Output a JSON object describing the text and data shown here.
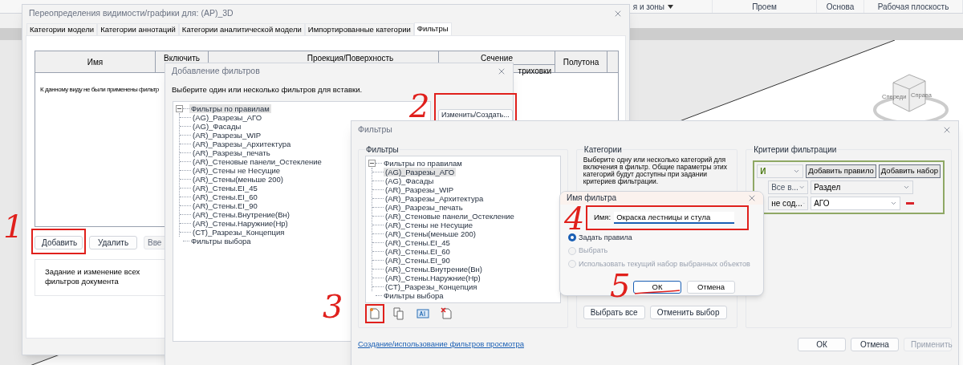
{
  "ribbon": {
    "items": [
      {
        "label": "я и зоны",
        "dropdown": true
      },
      {
        "label": "Проем",
        "dropdown": false
      },
      {
        "label": "Основа",
        "dropdown": false
      },
      {
        "label": "Рабочая плоскость",
        "dropdown": false
      }
    ]
  },
  "view_cube": {
    "faces": [
      "Спереди",
      "Справа"
    ]
  },
  "visibility_dialog": {
    "title": "Переопределения видимости/графики для: (АР)_3D",
    "tabs": [
      {
        "label": "Категории модели",
        "selected": false
      },
      {
        "label": "Категории аннотаций",
        "selected": false
      },
      {
        "label": "Категории аналитической модели",
        "selected": false
      },
      {
        "label": "Импортированные категории",
        "selected": false
      },
      {
        "label": "Фильтры",
        "selected": true
      }
    ],
    "columns": [
      {
        "label": "Имя"
      },
      {
        "label": "Включить"
      },
      {
        "label": "Проекция/Поверхность"
      },
      {
        "label": "Сечение",
        "sublabel": "триховки"
      },
      {
        "label": "Полутона"
      }
    ],
    "note": "К данному виду не были применены фильтр",
    "buttons": [
      {
        "label": "Добавить",
        "highlighted": true,
        "disabled": false
      },
      {
        "label": "Удалить",
        "highlighted": false,
        "disabled": false
      },
      {
        "label": "Вве",
        "highlighted": false,
        "disabled": true
      }
    ],
    "group_text": "Задание и изменение всех фильтров документа"
  },
  "add_filters_dialog": {
    "title": "Добавление фильтров",
    "prompt": "Выберите один или несколько фильтров для вставки.",
    "tree": [
      {
        "label": "Фильтры по правилам",
        "selected": true,
        "expanded": true,
        "children": [
          {
            "label": "(AG)_Разрезы_АГО",
            "selected": false
          },
          {
            "label": "(AG)_Фасады",
            "selected": false
          },
          {
            "label": "(AR)_Разрезы_WIP",
            "selected": false
          },
          {
            "label": "(AR)_Разрезы_Архитектура",
            "selected": false
          },
          {
            "label": "(AR)_Разрезы_печать",
            "selected": false
          },
          {
            "label": "(AR)_Стеновые панели_Остекление",
            "selected": false
          },
          {
            "label": "(AR)_Стены не Несущие",
            "selected": false
          },
          {
            "label": "(AR)_Стены(меньше 200)",
            "selected": false
          },
          {
            "label": "(AR)_Стены.EI_45",
            "selected": false
          },
          {
            "label": "(AR)_Стены.EI_60",
            "selected": false
          },
          {
            "label": "(AR)_Стены.EI_90",
            "selected": false
          },
          {
            "label": "(AR)_Стены.Внутрение(Вн)",
            "selected": false
          },
          {
            "label": "(AR)_Стены.Наружние(Нр)",
            "selected": false
          },
          {
            "label": "(CT)_Разрезы_Концепция",
            "selected": false
          }
        ]
      },
      {
        "label": "Фильтры выбора",
        "selected": false
      }
    ],
    "button": {
      "label": "Изменить/Создать...",
      "highlighted": true
    }
  },
  "filters_dialog": {
    "title": "Фильтры",
    "filters_group": {
      "title": "Фильтры",
      "tree": [
        {
          "label": "Фильтры по правилам",
          "selected": false,
          "expanded": true,
          "children": [
            {
              "label": "(AG)_Разрезы_АГО",
              "selected": true
            },
            {
              "label": "(AG)_Фасады",
              "selected": false
            },
            {
              "label": "(AR)_Разрезы_WIP",
              "selected": false
            },
            {
              "label": "(AR)_Разрезы_Архитектура",
              "selected": false
            },
            {
              "label": "(AR)_Разрезы_печать",
              "selected": false
            },
            {
              "label": "(AR)_Стеновые панели_Остекление",
              "selected": false
            },
            {
              "label": "(AR)_Стены не Несущие",
              "selected": false
            },
            {
              "label": "(AR)_Стены(меньше 200)",
              "selected": false
            },
            {
              "label": "(AR)_Стены.EI_45",
              "selected": false
            },
            {
              "label": "(AR)_Стены.EI_60",
              "selected": false
            },
            {
              "label": "(AR)_Стены.EI_90",
              "selected": false
            },
            {
              "label": "(AR)_Стены.Внутрение(Вн)",
              "selected": false
            },
            {
              "label": "(AR)_Стены.Наружние(Нр)",
              "selected": false
            },
            {
              "label": "(CT)_Разрезы_Концепция",
              "selected": false
            }
          ]
        },
        {
          "label": "Фильтры выбора",
          "selected": false
        }
      ],
      "tools": [
        {
          "kind": "new",
          "highlighted": true
        },
        {
          "kind": "copy",
          "highlighted": false
        },
        {
          "kind": "rename",
          "highlighted": false
        },
        {
          "kind": "delete",
          "highlighted": false
        }
      ]
    },
    "link": "Создание/использование фильтров просмотра",
    "categories_group": {
      "title": "Категории",
      "hint": "Выберите одну или несколько категорий для включения в фильтр. Общие параметры этих категорий будут доступны при задании критериев фильтрации.",
      "buttons": [
        "Выбрать все",
        "Отменить выбор"
      ]
    },
    "criteria_group": {
      "title": "Критерии фильтрации",
      "operator": "И",
      "buttons": [
        "Добавить правило",
        "Добавить набор"
      ],
      "rule": {
        "scope": "Все в...",
        "parameter": "Раздел",
        "condition": "не сод...",
        "value": "АГО"
      }
    },
    "buttons": [
      {
        "label": "ОК",
        "disabled": false
      },
      {
        "label": "Отмена",
        "disabled": false
      },
      {
        "label": "Применить",
        "disabled": true
      }
    ]
  },
  "name_dialog": {
    "title": "Имя фильтра",
    "field_label": "Имя:",
    "value": "Окраска лестницы и стула",
    "highlighted": true,
    "options": [
      {
        "label": "Задать правила",
        "selected": true,
        "disabled": false
      },
      {
        "label": "Выбрать",
        "selected": false,
        "disabled": true
      },
      {
        "label": "Использовать текущий набор выбранных объектов",
        "selected": false,
        "disabled": true
      }
    ],
    "buttons": [
      {
        "label": "ОК",
        "default": true,
        "underlined": true
      },
      {
        "label": "Отмена",
        "default": false,
        "underlined": false
      }
    ]
  },
  "annotations": [
    {
      "label": "1"
    },
    {
      "label": "2"
    },
    {
      "label": "3"
    },
    {
      "label": "4"
    },
    {
      "label": "5"
    }
  ]
}
